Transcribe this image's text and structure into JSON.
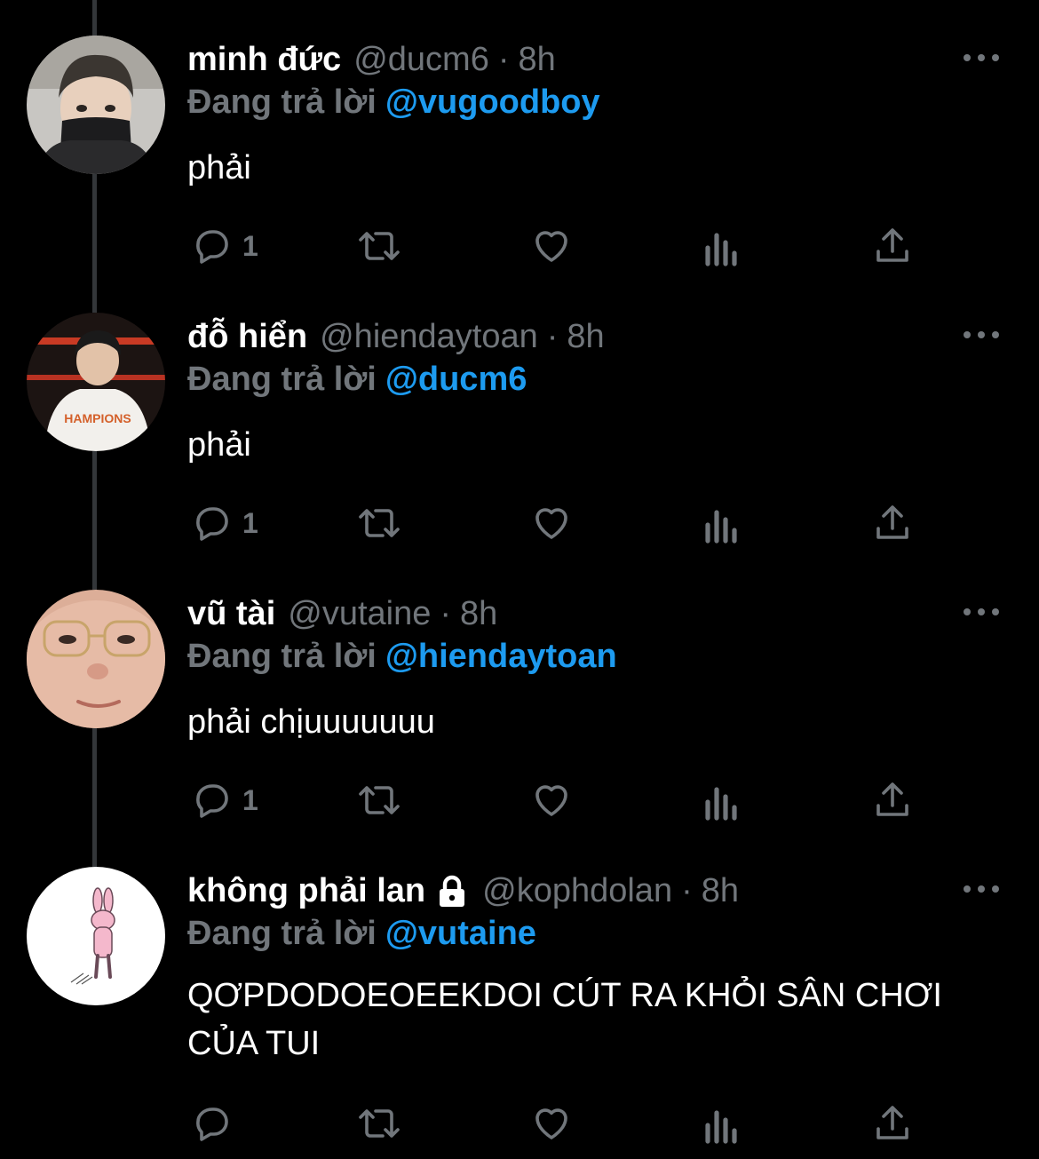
{
  "colors": {
    "background": "#000000",
    "text": "#ffffff",
    "muted": "#71767b",
    "accent": "#1d9bf0",
    "thread_line": "#333639"
  },
  "tweets": [
    {
      "display_name": "minh đức",
      "handle": "@ducm6",
      "separator": "·",
      "time": "8h",
      "replying_label": "Đang trả lời",
      "replying_to": "@vugoodboy",
      "text": "phải",
      "reply_count": "1",
      "avatar": "person-avatar-mask",
      "locked": false
    },
    {
      "display_name": "đỗ hiển",
      "handle": "@hiendaytoan",
      "separator": "·",
      "time": "8h",
      "replying_label": "Đang trả lời",
      "replying_to": "@ducm6",
      "text": "phải",
      "reply_count": "1",
      "avatar": "person-avatar-white-shirt",
      "locked": false
    },
    {
      "display_name": "vũ tài",
      "handle": "@vutaine",
      "separator": "·",
      "time": "8h",
      "replying_label": "Đang trả lời",
      "replying_to": "@hiendaytoan",
      "text": "phải chịuuuuuuu",
      "reply_count": "1",
      "avatar": "person-avatar-glasses",
      "locked": false
    },
    {
      "display_name": "không phải lan",
      "handle": "@kophdolan",
      "separator": "·",
      "time": "8h",
      "replying_label": "Đang trả lời",
      "replying_to": "@vutaine",
      "text": "QƠPDODOEOEEKDOI CÚT RA KHỎI SÂN CHƠI CỦA TUI",
      "reply_count": "",
      "avatar": "pink-bunny-avatar",
      "locked": true
    }
  ],
  "action_icons": [
    "reply-icon",
    "retweet-icon",
    "like-icon",
    "analytics-icon",
    "share-icon"
  ]
}
